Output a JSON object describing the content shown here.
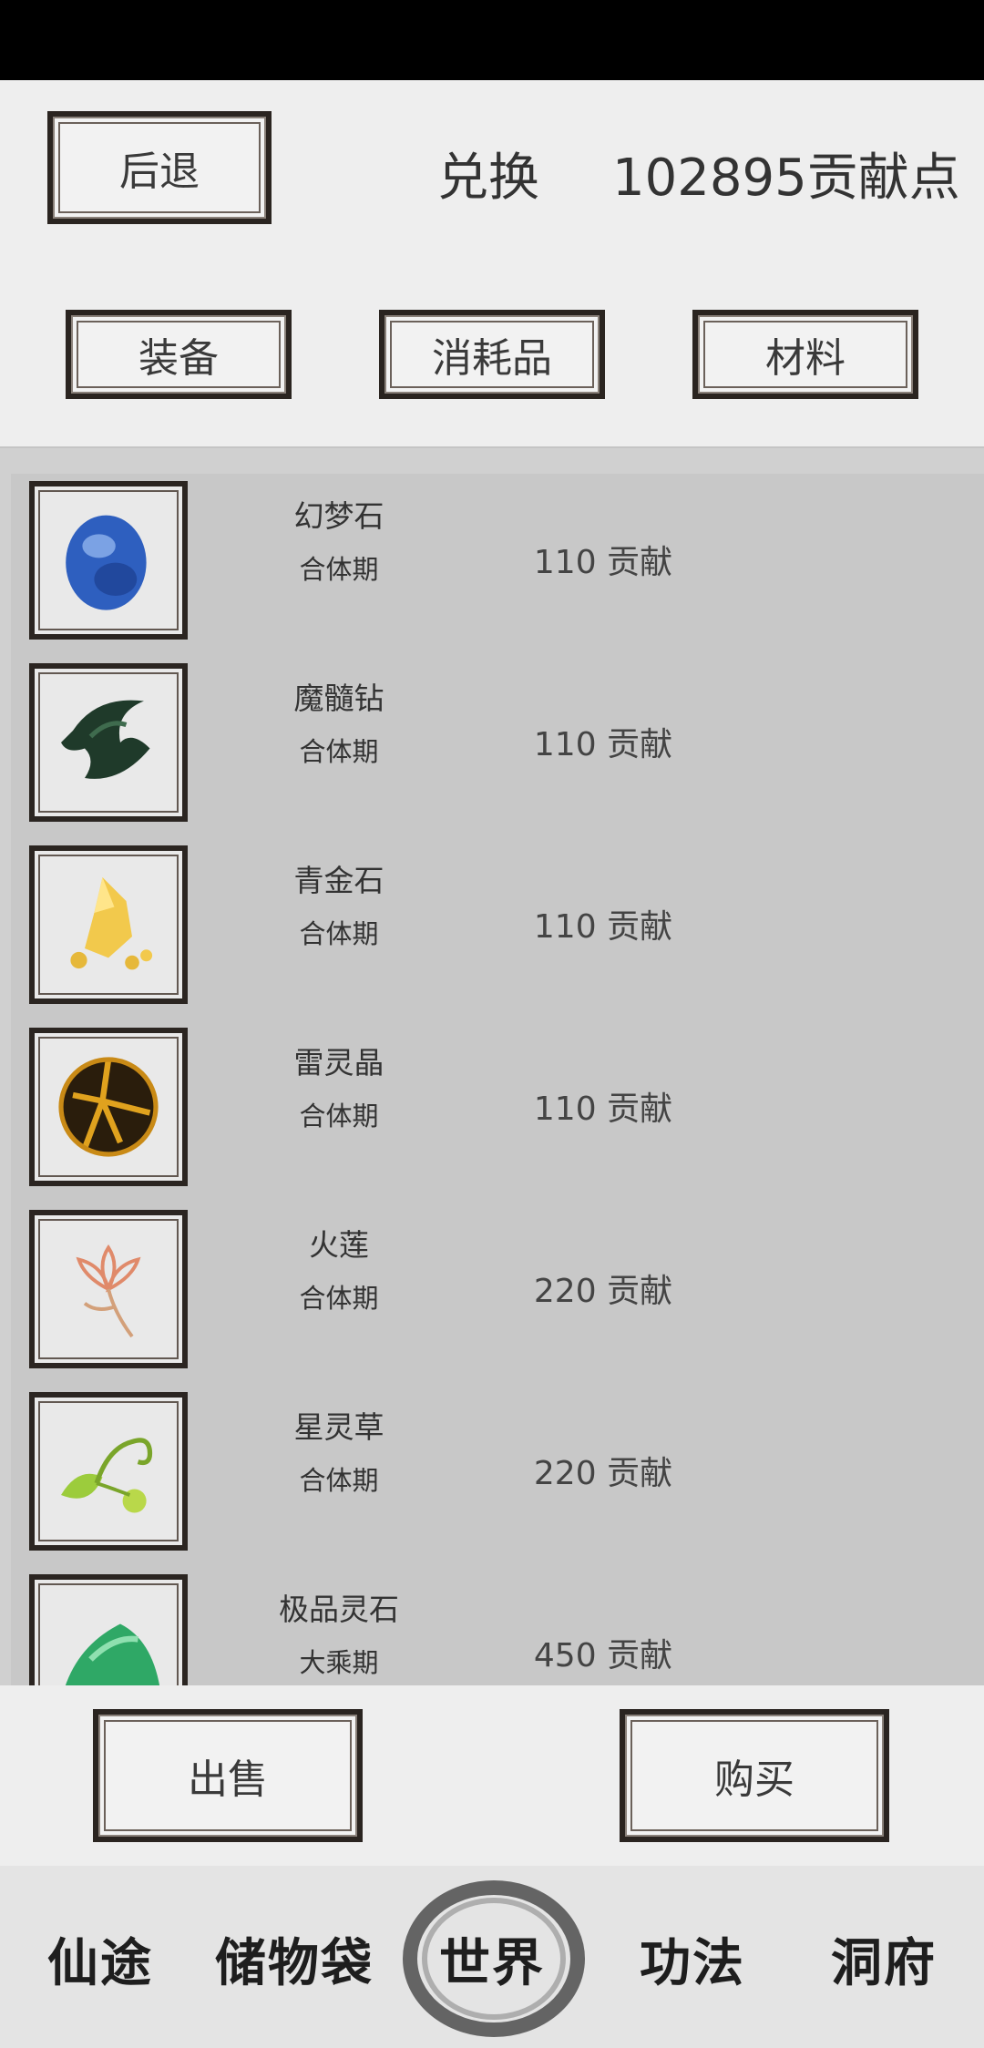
{
  "header": {
    "back_label": "后退",
    "title": "兑换",
    "points": "102895贡献点"
  },
  "tabs": [
    {
      "label": "装备"
    },
    {
      "label": "消耗品"
    },
    {
      "label": "材料"
    }
  ],
  "items": [
    {
      "name": "幻梦石",
      "level": "合体期",
      "price": "110 贡献",
      "icon": "blue-gem-icon"
    },
    {
      "name": "魔髓钻",
      "level": "合体期",
      "price": "110 贡献",
      "icon": "dark-claw-icon"
    },
    {
      "name": "青金石",
      "level": "合体期",
      "price": "110 贡献",
      "icon": "gold-ore-icon"
    },
    {
      "name": "雷灵晶",
      "level": "合体期",
      "price": "110 贡献",
      "icon": "thunder-orb-icon"
    },
    {
      "name": "火莲",
      "level": "合体期",
      "price": "220 贡献",
      "icon": "fire-lotus-icon"
    },
    {
      "name": "星灵草",
      "level": "合体期",
      "price": "220 贡献",
      "icon": "star-herb-icon"
    },
    {
      "name": "极品灵石",
      "level": "大乘期",
      "price": "450 贡献",
      "icon": "spirit-stone-icon"
    }
  ],
  "actions": {
    "sell_label": "出售",
    "buy_label": "购买"
  },
  "nav": [
    {
      "label": "仙途"
    },
    {
      "label": "储物袋"
    },
    {
      "label": "世界"
    },
    {
      "label": "功法"
    },
    {
      "label": "洞府"
    }
  ]
}
